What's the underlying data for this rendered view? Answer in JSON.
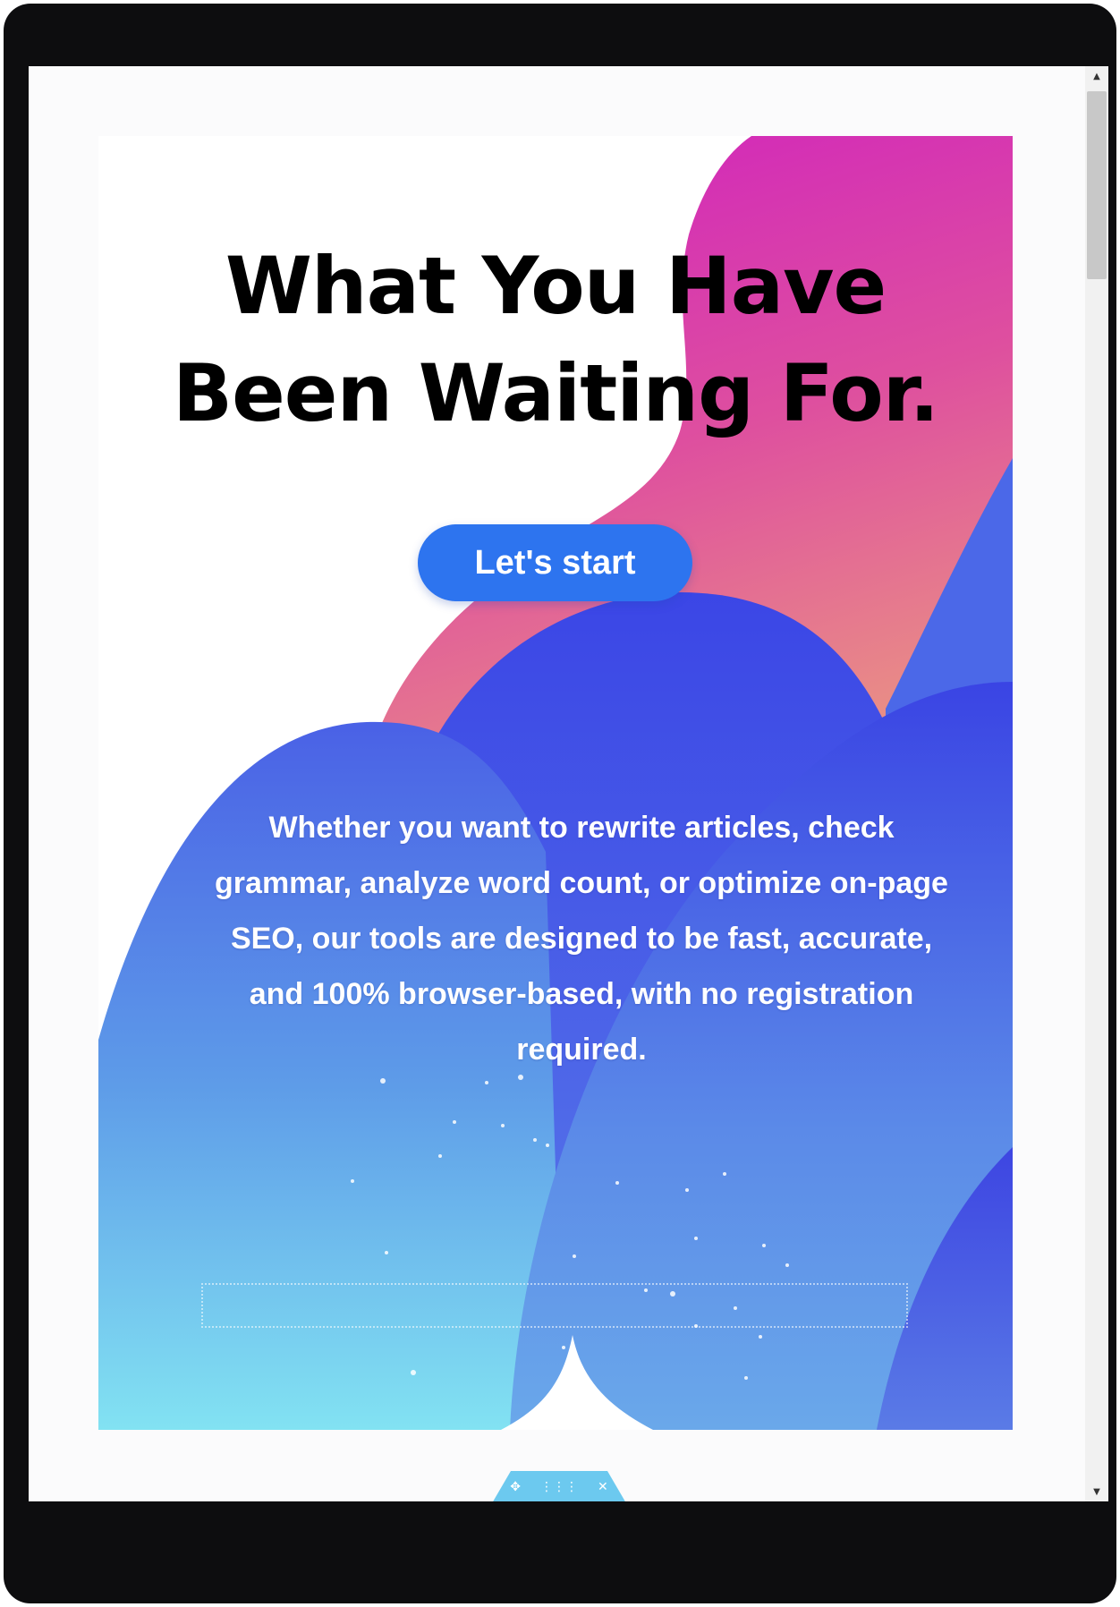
{
  "hero": {
    "headline_line1": "What You Have",
    "headline_line2": "Been Waiting For.",
    "cta_label": "Let's start",
    "description": "Whether you want to rewrite articles, check grammar, analyze word count, or optimize on-page SEO, our tools are designed to be fast, accurate, and 100% browser-based, with no registration required."
  },
  "toolbar": {
    "move_icon": "✥",
    "grid_icon": "⋮⋮⋮",
    "close_icon": "✕"
  },
  "scrollbar": {
    "up_icon": "▲",
    "down_icon": "▼"
  },
  "colors": {
    "magenta": "#d12fb4",
    "coral": "#e68790",
    "royal_blue": "#3b4fe6",
    "sky_blue": "#7fdff2",
    "button_blue": "#2d74ef"
  }
}
